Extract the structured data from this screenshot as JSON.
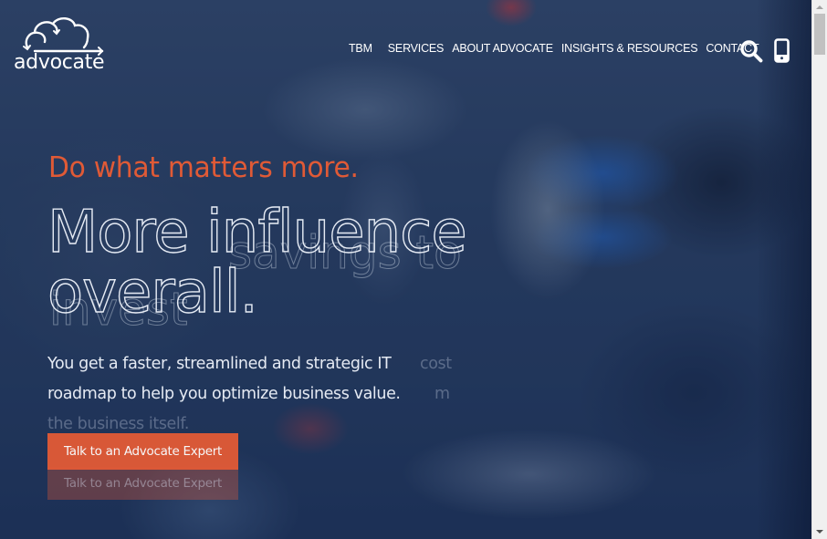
{
  "brand": {
    "name": "advocate",
    "logo_icon": "cloud-arrows-icon"
  },
  "nav": {
    "items": [
      {
        "label": "TBM"
      },
      {
        "label": "SERVICES"
      },
      {
        "label": "ABOUT ADVOCATE"
      },
      {
        "label": "INSIGHTS & RESOURCES"
      },
      {
        "label": "CONTACT"
      }
    ],
    "search_icon": "search-icon",
    "mobile_icon": "mobile-phone-icon"
  },
  "hero": {
    "tagline": "Do what matters more.",
    "headline_line1": "More influence",
    "headline_line2": "overall.",
    "body": "You get a faster, streamlined and strategic IT roadmap to help you optimize business value.",
    "cta_label": "Talk to an Advocate Expert",
    "accent_color": "#e05a36"
  },
  "hero_outgoing_slide": {
    "headline_line1": "savings to",
    "headline_line2": "invest",
    "body_fragment_1": "cost",
    "body_fragment_2": "m",
    "body_line3": "the business itself.",
    "cta_label": "Talk to an Advocate Expert"
  }
}
